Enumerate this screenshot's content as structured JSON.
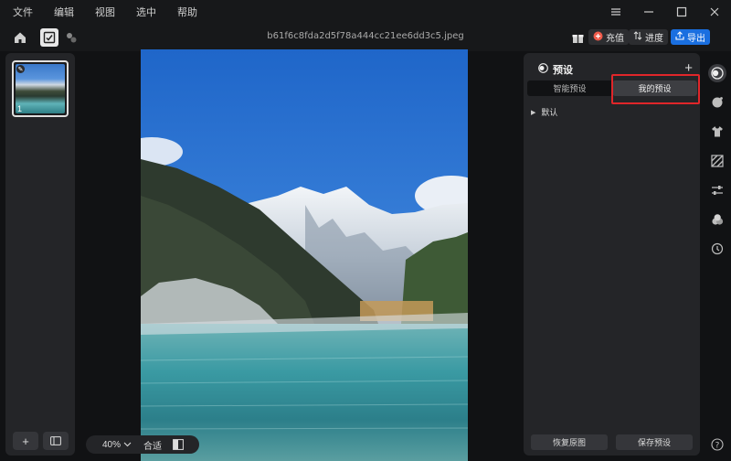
{
  "menu": [
    "文件",
    "编辑",
    "视图",
    "选中",
    "帮助"
  ],
  "toolbar": {
    "filename": "b61f6c8fda2d5f78a444cc21ee6dd3c5.jpeg",
    "charge_label": "充值",
    "progress_label": "进度",
    "export_label": "导出"
  },
  "thumbnails": [
    {
      "index": "1"
    }
  ],
  "zoom": {
    "value": "40%",
    "fit_label": "合适"
  },
  "presets": {
    "title": "预设",
    "tabs": [
      {
        "label": "智能预设",
        "active": false
      },
      {
        "label": "我的预设",
        "active": true
      }
    ],
    "items": [
      {
        "label": "默认"
      }
    ],
    "restore_label": "恢复原图",
    "save_label": "保存预设"
  },
  "tools": [
    "preset-icon",
    "color-icon",
    "shirt-icon",
    "hatch-icon",
    "adjust-icon",
    "blend-icon",
    "history-icon"
  ],
  "colors": {
    "accent": "#1a6fe0",
    "highlight": "#e0262a",
    "panel": "#242528",
    "background": "#111214"
  }
}
